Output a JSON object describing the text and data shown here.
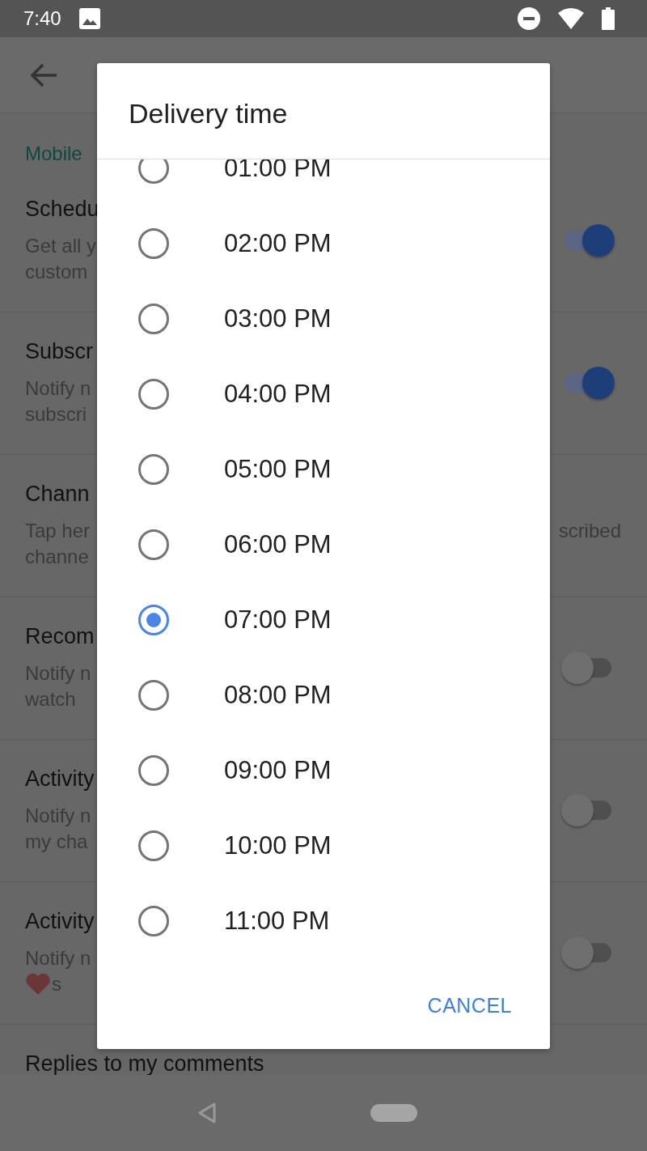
{
  "status_bar": {
    "time": "7:40"
  },
  "settings": {
    "section": "Mobile",
    "rows": [
      {
        "title": "Schedu",
        "lines": [
          {
            "text": "Get all y"
          },
          {
            "text": "custom"
          }
        ],
        "toggle": {
          "on": true
        }
      },
      {
        "title": "Subscr",
        "lines": [
          {
            "text": "Notify n"
          },
          {
            "text": "subscri"
          }
        ],
        "toggle": {
          "on": true
        }
      },
      {
        "title": "Chann",
        "lines": [
          {
            "text": "Tap her",
            "end_text": "scribed"
          },
          {
            "text": "channe"
          }
        ]
      },
      {
        "title": "Recom",
        "lines": [
          {
            "text": "Notify n"
          },
          {
            "text": "watch"
          }
        ],
        "toggle": {
          "on": false
        }
      },
      {
        "title": "Activity",
        "lines": [
          {
            "text": "Notify n"
          },
          {
            "text": "my cha"
          }
        ],
        "toggle": {
          "on": false
        }
      },
      {
        "title": "Activity",
        "lines": [
          {
            "text": "Notify n"
          },
          {
            "text": "s",
            "heart": true
          }
        ],
        "toggle": {
          "on": false
        }
      },
      {
        "title": "Replies to my comments",
        "lines": []
      }
    ]
  },
  "dialog": {
    "title": "Delivery time",
    "options": [
      {
        "label": "01:00 PM",
        "selected": false
      },
      {
        "label": "02:00 PM",
        "selected": false
      },
      {
        "label": "03:00 PM",
        "selected": false
      },
      {
        "label": "04:00 PM",
        "selected": false
      },
      {
        "label": "05:00 PM",
        "selected": false
      },
      {
        "label": "06:00 PM",
        "selected": false
      },
      {
        "label": "07:00 PM",
        "selected": true
      },
      {
        "label": "08:00 PM",
        "selected": false
      },
      {
        "label": "09:00 PM",
        "selected": false
      },
      {
        "label": "10:00 PM",
        "selected": false
      },
      {
        "label": "11:00 PM",
        "selected": false
      }
    ],
    "buttons": [
      "CANCEL"
    ]
  }
}
